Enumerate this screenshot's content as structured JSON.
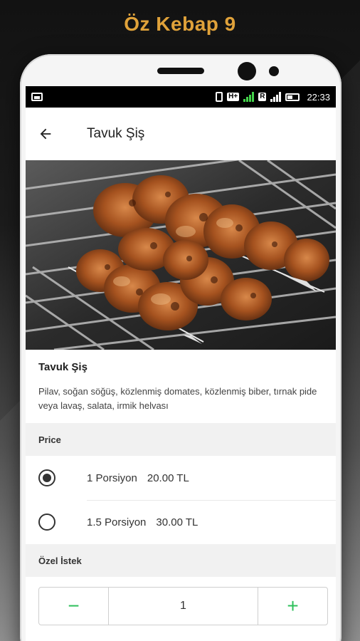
{
  "promo": {
    "title": "Öz Kebap 9"
  },
  "status_bar": {
    "time": "22:33",
    "network_badge": "H+",
    "roaming_badge": "R",
    "roaming_sub": "2"
  },
  "app_bar": {
    "title": "Tavuk Şiş",
    "back_icon": "arrow-left-icon"
  },
  "item": {
    "name": "Tavuk Şiş",
    "description": "Pilav, soğan söğüş, közlenmiş domates, közlenmiş biber, tırnak pide veya lavaş, salata, irmik helvası"
  },
  "price_section": {
    "header": "Price",
    "options": [
      {
        "label": "1 Porsiyon",
        "price": "20.00 TL",
        "selected": true
      },
      {
        "label": "1.5 Porsiyon",
        "price": "30.00 TL",
        "selected": false
      }
    ]
  },
  "special_request": {
    "header": "Özel İstek"
  },
  "quantity": {
    "value": "1",
    "minus_symbol": "−",
    "plus_symbol": "+"
  },
  "colors": {
    "accent_green": "#2ec05b",
    "promo_gold": "#e0a23a"
  }
}
